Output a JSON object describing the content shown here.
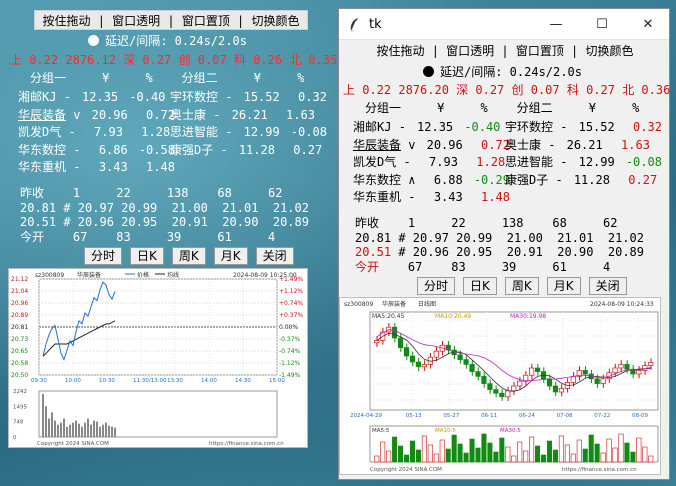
{
  "menu": {
    "label": "按住拖动 | 窗口透明 | 窗口置顶 | 切换颜色"
  },
  "left": {
    "delay": "延迟/间隔: 0.24s/2.0s",
    "index_line": "上 0.22 2876.12 深 0.27 创 0.07 科 0.26 北 0.35",
    "header": "分组一     ¥     %    分组二     ¥     %",
    "stocks_a": [
      {
        "name": "湘邮KJ",
        "marker": "-",
        "price": "12.35",
        "pct": "-0.40"
      },
      {
        "name": "华辰装备",
        "marker": "v",
        "price": "20.96",
        "pct": "0.72"
      },
      {
        "name": "凯发D气",
        "marker": "-",
        "price": "7.93",
        "pct": "1.28"
      },
      {
        "name": "华东数控",
        "marker": "-",
        "price": "6.86",
        "pct": "-0.58"
      },
      {
        "name": "华东重机",
        "marker": "-",
        "price": "3.43",
        "pct": "1.48"
      }
    ],
    "stocks_b": [
      {
        "name": "宇环数控",
        "marker": "-",
        "price": "15.52",
        "pct": "0.32"
      },
      {
        "name": "奥士康",
        "marker": "-",
        "price": "26.21",
        "pct": "1.63"
      },
      {
        "name": "思进智能",
        "marker": "-",
        "price": "12.99",
        "pct": "-0.08"
      },
      {
        "name": "康强D子",
        "marker": "-",
        "price": "11.28",
        "pct": "0.27"
      }
    ],
    "quote_lines": [
      "昨收    1     22     138    68     62",
      "20.81 # 20.97 20.99  21.00  21.01  21.02",
      "20.51 # 20.96 20.95  20.91  20.90  20.89",
      "今开    67    83     39     61     4"
    ],
    "buttons": [
      "分时",
      "日K",
      "周K",
      "月K",
      "关闭"
    ],
    "chart": {
      "code": "sz300809",
      "name": "华辰装备",
      "legend_price": "价格",
      "legend_avg": "均线",
      "datetime": "2024-08-09 10:25:00",
      "y_left": [
        "21.12",
        "21.04",
        "20.96",
        "20.89",
        "20.81",
        "20.73",
        "20.65",
        "20.58",
        "20.50"
      ],
      "y_right": [
        "+1.49%",
        "+1.12%",
        "+0.74%",
        "+0.37%",
        "0.00%",
        "-0.37%",
        "-0.74%",
        "-1.12%",
        "-1.49%"
      ],
      "x_labels": [
        "09:30",
        "10:00",
        "10:30",
        "11:30/13:00",
        "13:30",
        "14:00",
        "14:30",
        "15:00"
      ],
      "vol_labels": [
        "2242",
        "1495",
        "748",
        "0"
      ],
      "footer_left": "Copyright 2024 SINA.COM",
      "footer_right": "https://finance.sina.com.cn"
    }
  },
  "right": {
    "title": "tk",
    "delay": "延迟/间隔: 0.24s/2.0s",
    "index_line": "上 0.22 2876.20 深 0.27 创 0.07 科 0.27 北 0.36",
    "header": "分组一     ¥     %    分组二     ¥     %",
    "stocks_a": [
      {
        "name": "湘邮KJ",
        "marker": "-",
        "price": "12.35",
        "pct": "-0.40",
        "dir": "down"
      },
      {
        "name": "华辰装备",
        "marker": "v",
        "price": "20.96",
        "pct": "0.72",
        "dir": "up"
      },
      {
        "name": "凯发D气",
        "marker": "-",
        "price": "7.93",
        "pct": "1.28",
        "dir": "up"
      },
      {
        "name": "华东数控",
        "marker": "∧",
        "price": "6.88",
        "pct": "-0.29",
        "dir": "down"
      },
      {
        "name": "华东重机",
        "marker": "-",
        "price": "3.43",
        "pct": "1.48",
        "dir": "up"
      }
    ],
    "stocks_b": [
      {
        "name": "宇环数控",
        "marker": "-",
        "price": "15.52",
        "pct": "0.32",
        "dir": "up"
      },
      {
        "name": "奥士康",
        "marker": "-",
        "price": "26.21",
        "pct": "1.63",
        "dir": "up"
      },
      {
        "name": "思进智能",
        "marker": "-",
        "price": "12.99",
        "pct": "-0.08",
        "dir": "down"
      },
      {
        "name": "康强D子",
        "marker": "-",
        "price": "11.28",
        "pct": "0.27",
        "dir": "up"
      }
    ],
    "quote_lines": [
      "昨收    1     22     138    68     62",
      "20.81 # 20.97 20.99  21.00  21.01  21.02",
      "20.51 # 20.96 20.95  20.91  20.90  20.89",
      "今开    67    83     39     61     4"
    ],
    "buttons": [
      "分时",
      "日K",
      "周K",
      "月K",
      "关闭"
    ],
    "chart": {
      "code": "sz300809",
      "name": "华辰装备",
      "kind": "日线图",
      "datetime": "2024-08-09 10:24:33",
      "ma5": "MA5:20.45",
      "ma10": "MA10:20.49",
      "ma30": "MA30:19.98",
      "vma5": "MA5:5",
      "vma10": "MA10:5",
      "vma30": "MA30:5",
      "x_labels": [
        "2024-04-29",
        "05-13",
        "05-27",
        "06-11",
        "06-24",
        "07-08",
        "07-22",
        "08-09"
      ],
      "footer_left": "Copyright 2024 SINA.COM",
      "footer_right": "https://finance.sina.com.cn"
    }
  },
  "colors": {
    "up": "#d01010",
    "down": "#138a13",
    "price_line": "#1f6fd6",
    "avg_line": "#222222"
  }
}
